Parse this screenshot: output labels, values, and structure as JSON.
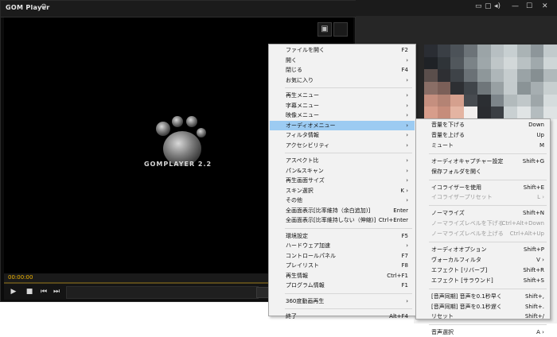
{
  "player": {
    "brand": "GOM Player",
    "gear_icon": "⚙",
    "logo_text": "GOMPLAYER 2.2",
    "time": "00:00:00",
    "window_controls": [
      "▭",
      "▢",
      "▯",
      "◂)",
      "|",
      "—",
      "☐",
      "✕"
    ]
  },
  "menu": {
    "items": [
      {
        "label": "ファイルを開く",
        "shortcut": "F2",
        "type": "item"
      },
      {
        "label": "開く",
        "shortcut": "›",
        "type": "item"
      },
      {
        "label": "閉じる",
        "shortcut": "F4",
        "type": "item"
      },
      {
        "label": "お気に入り",
        "shortcut": "›",
        "type": "item"
      },
      {
        "type": "sep"
      },
      {
        "label": "再生メニュー",
        "shortcut": "›",
        "type": "item"
      },
      {
        "label": "字幕メニュー",
        "shortcut": "›",
        "type": "item"
      },
      {
        "label": "映像メニュー",
        "shortcut": "›",
        "type": "item"
      },
      {
        "label": "オーディオメニュー",
        "shortcut": "›",
        "type": "item",
        "active": true
      },
      {
        "label": "フィルタ情報",
        "shortcut": "›",
        "type": "item"
      },
      {
        "label": "アクセシビリティ",
        "shortcut": "›",
        "type": "item"
      },
      {
        "type": "sep"
      },
      {
        "label": "アスペクト比",
        "shortcut": "›",
        "type": "item"
      },
      {
        "label": "パン&スキャン",
        "shortcut": "›",
        "type": "item"
      },
      {
        "label": "再生画面サイズ",
        "shortcut": "›",
        "type": "item"
      },
      {
        "label": "スキン選択",
        "shortcut": "K ›",
        "type": "item"
      },
      {
        "label": "その他",
        "shortcut": "›",
        "type": "item"
      },
      {
        "label": "全画面表示[比率維持（余白追加)]",
        "shortcut": "Enter",
        "type": "item"
      },
      {
        "label": "全画面表示[比率維持しない（伸縮)]",
        "shortcut": "Ctrl+Enter",
        "type": "item"
      },
      {
        "type": "sep"
      },
      {
        "label": "環境設定",
        "shortcut": "F5",
        "type": "item"
      },
      {
        "label": "ハードウェア加速",
        "shortcut": "›",
        "type": "item"
      },
      {
        "label": "コントロールパネル",
        "shortcut": "F7",
        "type": "item"
      },
      {
        "label": "プレイリスト",
        "shortcut": "F8",
        "type": "item"
      },
      {
        "label": "再生情報",
        "shortcut": "Ctrl+F1",
        "type": "item"
      },
      {
        "label": "プログラム情報",
        "shortcut": "F1",
        "type": "item"
      },
      {
        "type": "sep"
      },
      {
        "label": "360度動画再生",
        "shortcut": "›",
        "type": "item"
      },
      {
        "type": "sep"
      },
      {
        "label": "終了",
        "shortcut": "Alt+F4",
        "type": "item"
      }
    ]
  },
  "submenu": {
    "items": [
      {
        "label": "音量を下げる",
        "shortcut": "Down",
        "type": "item"
      },
      {
        "label": "音量を上げる",
        "shortcut": "Up",
        "type": "item"
      },
      {
        "label": "ミュート",
        "shortcut": "M",
        "type": "item"
      },
      {
        "type": "sep"
      },
      {
        "label": "オーディオキャプチャー設定",
        "shortcut": "Shift+G",
        "type": "item"
      },
      {
        "label": "保存フォルダを開く",
        "shortcut": "",
        "type": "item"
      },
      {
        "type": "sep"
      },
      {
        "label": "イコライザーを使用",
        "shortcut": "Shift+E",
        "type": "item"
      },
      {
        "label": "イコライザープリセット",
        "shortcut": "L ›",
        "type": "item",
        "disabled": true
      },
      {
        "type": "sep"
      },
      {
        "label": "ノーマライズ",
        "shortcut": "Shift+N",
        "type": "item"
      },
      {
        "label": "ノーマライズレベルを下げる",
        "shortcut": "Ctrl+Alt+Down",
        "type": "item",
        "disabled": true
      },
      {
        "label": "ノーマライズレベルを上げる",
        "shortcut": "Ctrl+Alt+Up",
        "type": "item",
        "disabled": true
      },
      {
        "type": "sep"
      },
      {
        "label": "オーディオオプション",
        "shortcut": "Shift+P",
        "type": "item"
      },
      {
        "label": "ヴォーカルフィルタ",
        "shortcut": "V ›",
        "type": "item"
      },
      {
        "label": "エフェクト [リバーブ]",
        "shortcut": "Shift+R",
        "type": "item"
      },
      {
        "label": "エフェクト [サラウンド]",
        "shortcut": "Shift+S",
        "type": "item"
      },
      {
        "type": "sep"
      },
      {
        "label": "[音声同期] 音声を0.1秒早く",
        "shortcut": "Shift+,",
        "type": "item"
      },
      {
        "label": "[音声同期] 音声を0.1秒遅く",
        "shortcut": "Shift+.",
        "type": "item"
      },
      {
        "label": "リセット",
        "shortcut": "Shift+/",
        "type": "item"
      },
      {
        "type": "sep"
      },
      {
        "label": "音声選択",
        "shortcut": "A ›",
        "type": "item"
      }
    ]
  },
  "mosaic_colors": [
    "#2a2d33",
    "#3a3f45",
    "#4c5258",
    "#6c7378",
    "#9ba4a7",
    "#b7bfc2",
    "#c7cfd1",
    "#aab3b5",
    "#8d969a",
    "#c2cacc",
    "#1f2226",
    "#2f3438",
    "#51575c",
    "#7b8387",
    "#9ea7aa",
    "#bfc6c8",
    "#d2d8d9",
    "#b9c1c3",
    "#a0a9ac",
    "#cfd6d7",
    "#5a4e4b",
    "#2e2f33",
    "#3e4348",
    "#6a7176",
    "#8e979a",
    "#aeb6b9",
    "#c5ccce",
    "#9aa3a6",
    "#868f92",
    "#b1b9bb",
    "#8a6e66",
    "#7b5f58",
    "#2d2f33",
    "#40454a",
    "#6f767a",
    "#98a0a3",
    "#c4cbcd",
    "#8a9396",
    "#a6aeb1",
    "#c8cfd0",
    "#c58f7f",
    "#b48374",
    "#d5a08e",
    "#474b50",
    "#2b2e32",
    "#7d858a",
    "#b2babc",
    "#c0c7c9",
    "#9ea6a9",
    "#d6dcdd",
    "#d79d8b",
    "#c68c7b",
    "#e4b4a2",
    "#f2efee",
    "#2a2c30",
    "#3b3f44",
    "#c9d0d2",
    "#e0e4e5",
    "#b4bcbf",
    "#dfe3e4"
  ]
}
